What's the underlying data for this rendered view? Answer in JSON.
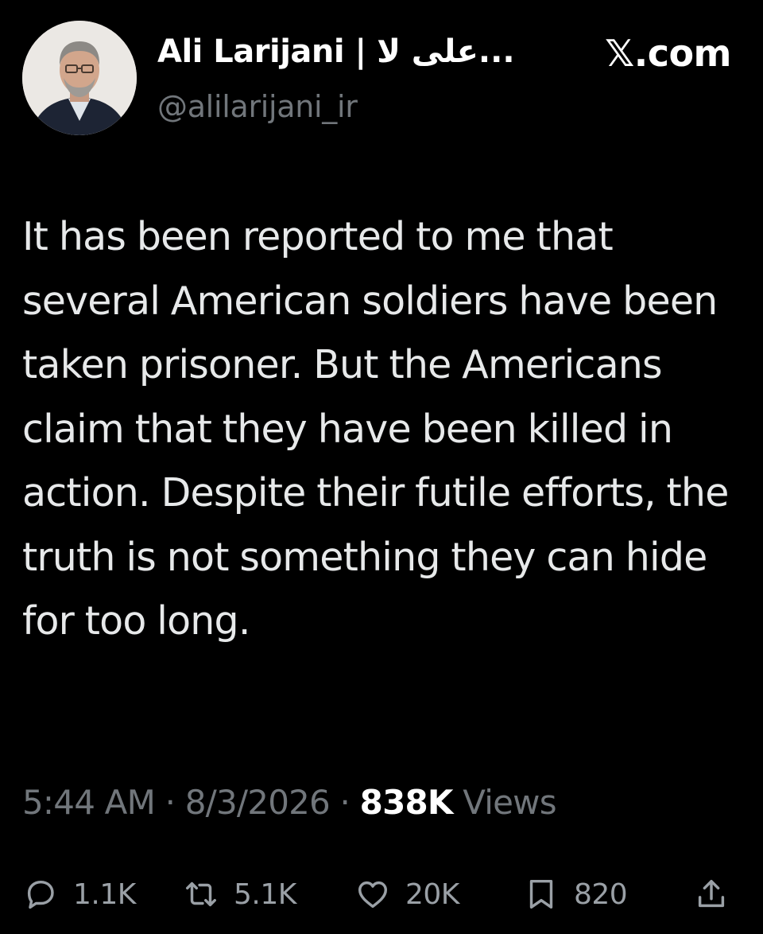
{
  "author": {
    "display_name": "Ali Larijani | على لا...",
    "handle": "@alilarijani_ir"
  },
  "brand": "𝕏.com",
  "tweet": {
    "text": "It has been reported to me that several American soldiers have been taken prisoner. But the Americans claim that they have been killed in action. Despite their futile efforts, the truth is not something they can hide for too long."
  },
  "meta": {
    "time": "5:44 AM",
    "date": "8/3/2026",
    "separator": "·",
    "views_count": "838K",
    "views_label": "Views"
  },
  "actions": {
    "replies": "1.1K",
    "reposts": "5.1K",
    "likes": "20K",
    "bookmarks": "820"
  },
  "colors": {
    "background": "#000000",
    "primary_text": "#e7e9ea",
    "secondary_text": "#71767b"
  },
  "icons": [
    "reply-icon",
    "repost-icon",
    "like-icon",
    "bookmark-icon",
    "share-icon"
  ]
}
